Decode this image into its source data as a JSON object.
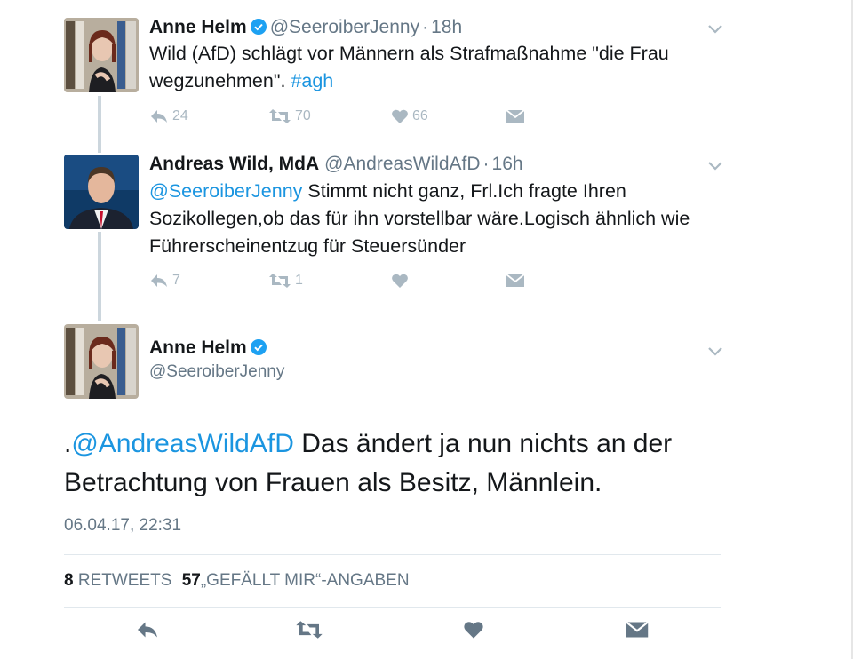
{
  "tweet1": {
    "name": "Anne Helm",
    "handle": "@SeeroiberJenny",
    "sep": "·",
    "time": "18h",
    "text_main": "Wild (AfD) schlägt vor Männern als Strafmaßnahme \"die Frau wegzunehmen\". ",
    "hashtag": "#agh",
    "replies": "24",
    "retweets": "70",
    "likes": "66"
  },
  "tweet2": {
    "name": "Andreas Wild, MdA",
    "handle": "@AndreasWildAfD",
    "sep": "·",
    "time": "16h",
    "mention": "@SeeroiberJenny",
    "text_main": " Stimmt nicht ganz, Frl.Ich fragte Ihren Sozikollegen,ob das für ihn vorstellbar wäre.Logisch ähnlich wie Führerscheinentzug für Steuersünder",
    "replies": "7",
    "retweets": "1"
  },
  "tweet3": {
    "name": "Anne Helm",
    "handle": "@SeeroiberJenny",
    "prefix": ".",
    "mention": "@AndreasWildAfD",
    "text_main": " Das ändert ja nun nichts an der Betrachtung von Frauen als Besitz, Männlein.",
    "timestamp": "06.04.17, 22:31",
    "retweet_count": "8",
    "retweet_label": "RETWEETS",
    "like_count": "57",
    "like_label": "„GEFÄLLT MIR“-ANGABEN"
  },
  "icons": {
    "reply": "reply-icon",
    "retweet": "retweet-icon",
    "like": "heart-icon",
    "dm": "envelope-icon",
    "verified": "verified-badge-icon",
    "menu": "chevron-down-icon"
  },
  "colors": {
    "link": "#1b95e0",
    "muted": "#657786",
    "action": "#aab8c2",
    "verified": "#1da1f2"
  }
}
